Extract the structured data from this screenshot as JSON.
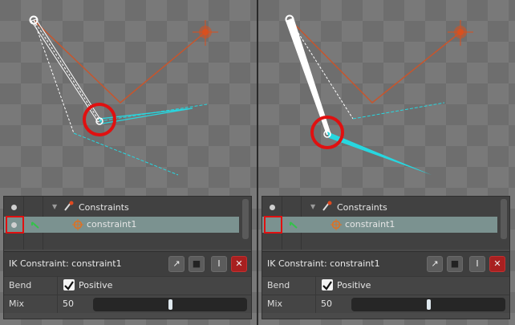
{
  "panes": [
    {
      "tree": {
        "parent_label": "Constraints",
        "child_label": "constraint1"
      },
      "editor": {
        "title": "IK Constraint: constraint1",
        "bend_label": "Bend",
        "bend_checked": true,
        "bend_option": "Positive",
        "mix_label": "Mix",
        "mix_value": "50",
        "mix_fraction": 0.5
      }
    },
    {
      "tree": {
        "parent_label": "Constraints",
        "child_label": "constraint1"
      },
      "editor": {
        "title": "IK Constraint: constraint1",
        "bend_label": "Bend",
        "bend_checked": true,
        "bend_option": "Positive",
        "mix_label": "Mix",
        "mix_value": "50",
        "mix_fraction": 0.5
      }
    }
  ],
  "icons": {
    "constraints_group": "ik-chain-icon",
    "constraint_item": "crosshair-target-icon",
    "visibility": "dot-icon",
    "bone_key": "bone-key-icon",
    "toolbar": [
      "pose-tool-icon",
      "bones-tool-icon",
      "rename-icon",
      "delete-icon"
    ]
  },
  "colors": {
    "bone_cyan": "#27d7e0",
    "ik_chain_orange": "#c8552c",
    "target_orange": "#d9501e",
    "highlight_red": "#e01010",
    "selected_row": "#7b9290"
  }
}
